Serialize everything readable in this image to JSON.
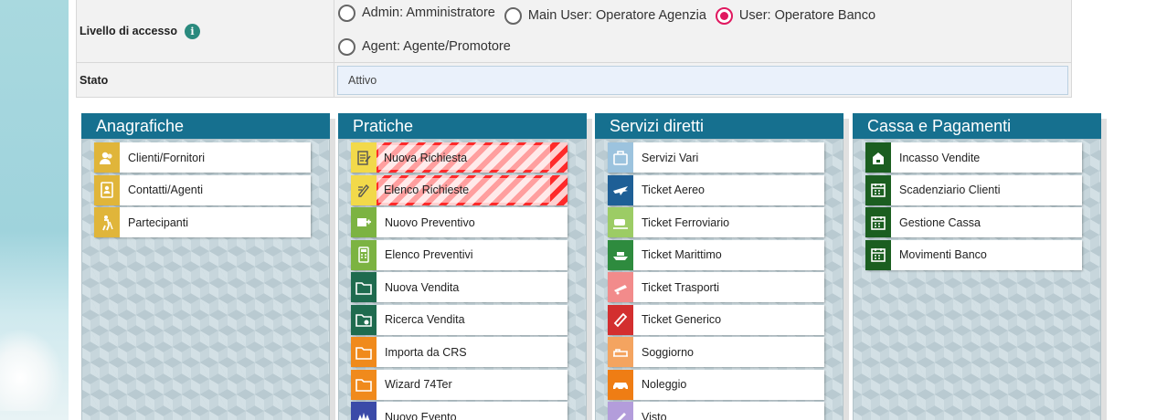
{
  "form": {
    "access_label": "Livello di accesso",
    "access_options": [
      {
        "label": "Admin: Amministratore",
        "selected": false
      },
      {
        "label": "Main User: Operatore Agenzia",
        "selected": false
      },
      {
        "label": "User: Operatore Banco",
        "selected": true
      },
      {
        "label": "Agent: Agente/Promotore",
        "selected": false
      }
    ],
    "stato_label": "Stato",
    "stato_value": "Attivo"
  },
  "panels": [
    {
      "title": "Anagrafiche",
      "items": [
        {
          "label": "Clienti/Fornitori",
          "icon": "users-icon",
          "color": "#e0b53a"
        },
        {
          "label": "Contatti/Agenti",
          "icon": "address-book-icon",
          "color": "#e0b53a"
        },
        {
          "label": "Partecipanti",
          "icon": "traveler-icon",
          "color": "#e0b53a"
        }
      ]
    },
    {
      "title": "Pratiche",
      "items": [
        {
          "label": "Nuova Richiesta",
          "icon": "new-request-icon",
          "color": "#f2d94a",
          "striped": true
        },
        {
          "label": "Elenco Richieste",
          "icon": "request-list-icon",
          "color": "#f2d94a",
          "striped": true
        },
        {
          "label": "Nuovo Preventivo",
          "icon": "new-quote-icon",
          "color": "#7cb342"
        },
        {
          "label": "Elenco Preventivi",
          "icon": "calculator-icon",
          "color": "#7cb342"
        },
        {
          "label": "Nuova Vendita",
          "icon": "folder-icon",
          "color": "#1f6b4f"
        },
        {
          "label": "Ricerca Vendita",
          "icon": "folder-search-icon",
          "color": "#1f6b4f"
        },
        {
          "label": "Importa da CRS",
          "icon": "folder-import-icon",
          "color": "#f08a1c"
        },
        {
          "label": "Wizard 74Ter",
          "icon": "folder-wizard-icon",
          "color": "#f08a1c"
        },
        {
          "label": "Nuovo Evento",
          "icon": "event-icon",
          "color": "#3b4aa8"
        }
      ]
    },
    {
      "title": "Servizi diretti",
      "items": [
        {
          "label": "Servizi Vari",
          "icon": "suitcase-icon",
          "color": "#9cc3de"
        },
        {
          "label": "Ticket Aereo",
          "icon": "airplane-icon",
          "color": "#1e5f96"
        },
        {
          "label": "Ticket Ferroviario",
          "icon": "train-icon",
          "color": "#9ccc65"
        },
        {
          "label": "Ticket Marittimo",
          "icon": "ship-icon",
          "color": "#2e8b3e"
        },
        {
          "label": "Ticket Trasporti",
          "icon": "transport-icon",
          "color": "#f28b8b"
        },
        {
          "label": "Ticket Generico",
          "icon": "ticket-icon",
          "color": "#d32f2f"
        },
        {
          "label": "Soggiorno",
          "icon": "bed-icon",
          "color": "#f4a460"
        },
        {
          "label": "Noleggio",
          "icon": "car-icon",
          "color": "#ef7d14"
        },
        {
          "label": "Visto",
          "icon": "visa-icon",
          "color": "#b39ddb"
        }
      ]
    },
    {
      "title": "Cassa e Pagamenti",
      "items": [
        {
          "label": "Incasso Vendite",
          "icon": "cash-register-icon",
          "color": "#1b5e20"
        },
        {
          "label": "Scadenziario Clienti",
          "icon": "calendar-icon",
          "color": "#1b5e20"
        },
        {
          "label": "Gestione Cassa",
          "icon": "calendar-icon",
          "color": "#1b5e20"
        },
        {
          "label": "Movimenti Banco",
          "icon": "calendar-icon",
          "color": "#1b5e20"
        }
      ]
    }
  ]
}
